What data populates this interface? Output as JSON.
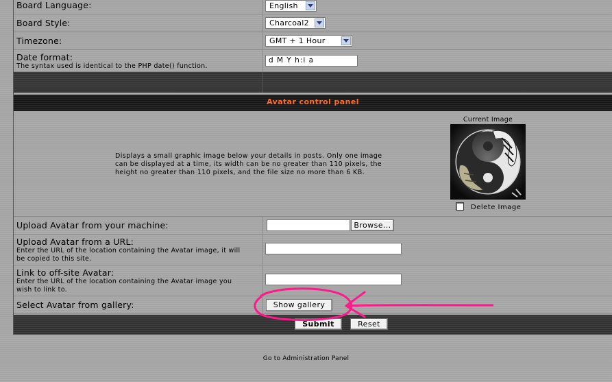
{
  "settings": {
    "board_language_label": "Board Language:",
    "board_language_value": "English",
    "board_style_label": "Board Style:",
    "board_style_value": "Charcoal2",
    "timezone_label": "Timezone:",
    "timezone_value": "GMT + 1 Hour",
    "date_format_label": "Date format:",
    "date_format_help": "The syntax used is identical to the PHP date() function.",
    "date_format_value": "d M Y h:i a"
  },
  "avatar": {
    "header": "Avatar control panel",
    "description_lines": [
      "Displays a small graphic image below your details in posts. Only one image",
      "can be displayed at a time, its width can be no greater than 110 pixels, the",
      "height no greater than 110 pixels, and the file size no more than 6 KB."
    ],
    "current_image_label": "Current Image",
    "delete_image_label": "Delete Image",
    "upload_machine_label": "Upload Avatar from your machine:",
    "browse_label": "Browse...",
    "upload_url_label": "Upload Avatar from a URL:",
    "upload_url_help_lines": [
      "Enter the URL of the location containing the Avatar image, it will",
      "be copied to this site."
    ],
    "link_offsite_label": "Link to off-site Avatar:",
    "link_offsite_help_lines": [
      "Enter the URL of the location containing the Avatar image you",
      "wish to link to."
    ],
    "gallery_label": "Select Avatar from gallery:",
    "show_gallery_label": "Show gallery"
  },
  "actions": {
    "submit_label": "Submit",
    "reset_label": "Reset"
  },
  "footer": {
    "admin_link": "Go to Administration Panel"
  },
  "colors": {
    "header_text": "#ff6a2a",
    "annotation": "#ff1a8c"
  }
}
